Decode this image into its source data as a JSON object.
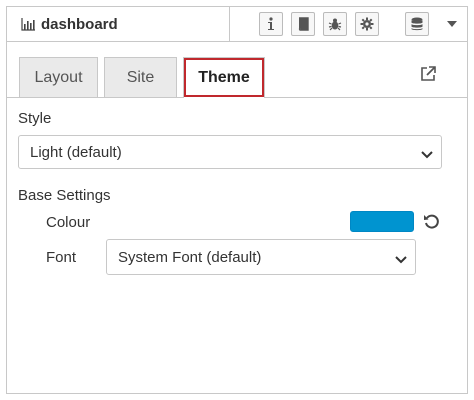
{
  "header": {
    "panel_title": "dashboard",
    "panel_icon": "bar-chart-icon",
    "toolbar_icons": [
      "info-icon",
      "book-icon",
      "bug-icon",
      "gear-icon",
      "database-icon"
    ],
    "menu_icon": "caret-down-icon"
  },
  "tabs": [
    {
      "label": "Layout",
      "active": false
    },
    {
      "label": "Site",
      "active": false
    },
    {
      "label": "Theme",
      "active": true
    }
  ],
  "popout_icon": "external-link-icon",
  "style": {
    "label": "Style",
    "value": "Light (default)"
  },
  "base_settings": {
    "label": "Base Settings",
    "colour_label": "Colour",
    "colour_value": "#0094d0",
    "reset_icon": "undo-icon",
    "font_label": "Font",
    "font_value": "System Font (default)"
  }
}
